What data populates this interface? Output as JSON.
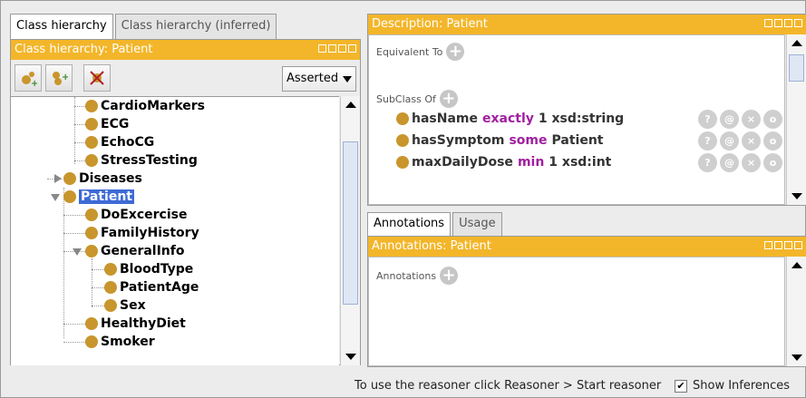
{
  "left": {
    "tabs": [
      "Class hierarchy",
      "Class hierarchy (inferred)"
    ],
    "panel_title": "Class hierarchy: Patient",
    "dropdown_value": "Asserted",
    "tree": [
      "CardioMarkers",
      "ECG",
      "EchoCG",
      "StressTesting",
      "Diseases",
      "Patient",
      "DoExcercise",
      "FamilyHistory",
      "GeneralInfo",
      "BloodType",
      "PatientAge",
      "Sex",
      "HealthyDiet",
      "Smoker"
    ]
  },
  "description": {
    "title": "Description: Patient",
    "equivalent_label": "Equivalent To",
    "subclass_label": "SubClass Of",
    "axioms": [
      {
        "prop": "hasName",
        "kw": "exactly",
        "rest": "1 xsd:string"
      },
      {
        "prop": "hasSymptom",
        "kw": "some",
        "rest": "Patient"
      },
      {
        "prop": "maxDailyDose",
        "kw": "min",
        "rest": "1 xsd:int"
      }
    ],
    "axiom_buttons": [
      "?",
      "@",
      "×",
      "o"
    ]
  },
  "right_tabs": [
    "Annotations",
    "Usage"
  ],
  "annotations": {
    "title": "Annotations: Patient",
    "label": "Annotations"
  },
  "status": {
    "text": "To use the reasoner click Reasoner > Start reasoner",
    "checkbox_label": "Show Inferences",
    "checked": true
  },
  "colors": {
    "title_bar": "#f3b62a",
    "class_dot": "#c8962c",
    "keyword": "#a020a0",
    "selection": "#3d6ad6"
  }
}
